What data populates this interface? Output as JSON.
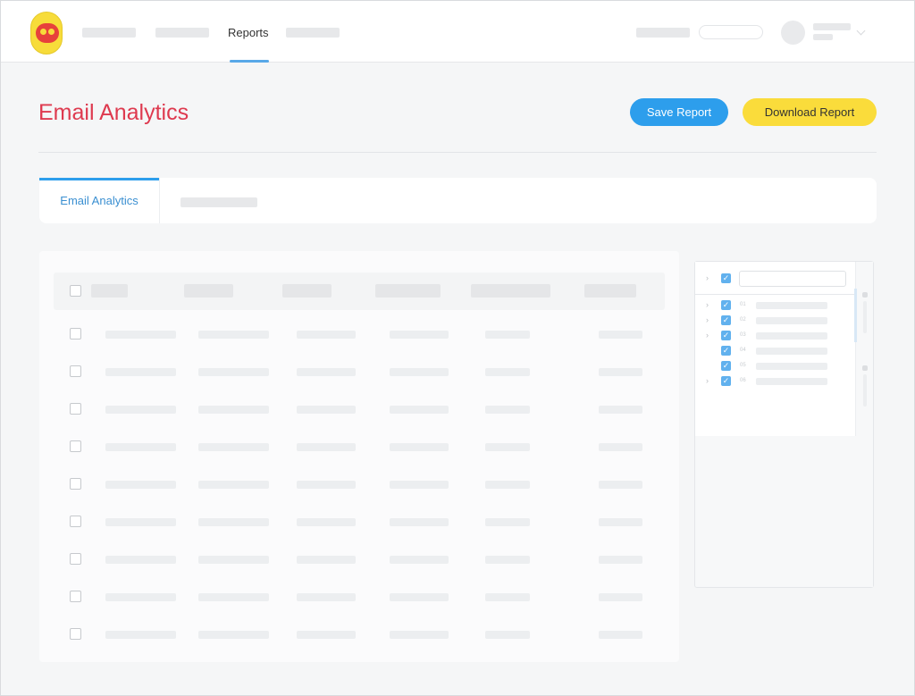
{
  "nav": {
    "active_item": "Reports"
  },
  "header": {
    "title": "Email Analytics",
    "save_button": "Save Report",
    "download_button": "Download Report"
  },
  "tabs": {
    "active_label": "Email Analytics"
  },
  "colors": {
    "title": "#de3a4f",
    "save_button": "#2d9eec",
    "download_button": "#fadc3b",
    "tab_accent": "#2d9eec",
    "tree_checkbox": "#61b1ee"
  },
  "icons": {
    "logo": "brand-logo-icon",
    "caret": "chevron-down-icon",
    "tree_expand": "chevron-right-icon",
    "checkbox": "checkbox-icon"
  },
  "tree": {
    "items": [
      {
        "label": "01",
        "expandable": true
      },
      {
        "label": "02",
        "expandable": true
      },
      {
        "label": "03",
        "expandable": true
      },
      {
        "label": "04",
        "expandable": false
      },
      {
        "label": "05",
        "expandable": false
      },
      {
        "label": "06",
        "expandable": true
      }
    ]
  }
}
